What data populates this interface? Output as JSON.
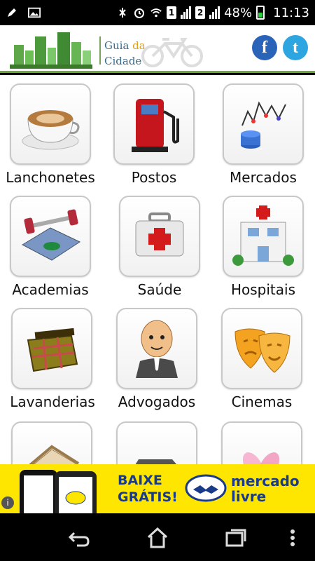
{
  "status_bar": {
    "sim1": "1",
    "sim2": "2",
    "battery": "48%",
    "time": "11:13"
  },
  "header": {
    "logo_text_1a": "Guia",
    "logo_text_1b": "da",
    "logo_text_2": "Cidade",
    "facebook_glyph": "f",
    "twitter_glyph": "t"
  },
  "categories": [
    {
      "label": "Lanchonetes",
      "icon": "coffee-cup-icon"
    },
    {
      "label": "Postos",
      "icon": "gas-pump-icon"
    },
    {
      "label": "Mercados",
      "icon": "market-chart-icon"
    },
    {
      "label": "Academias",
      "icon": "gym-equipment-icon"
    },
    {
      "label": "Saúde",
      "icon": "first-aid-kit-icon"
    },
    {
      "label": "Hospitais",
      "icon": "hospital-icon"
    },
    {
      "label": "Lavanderias",
      "icon": "laundry-basket-icon"
    },
    {
      "label": "Advogados",
      "icon": "lawyer-icon"
    },
    {
      "label": "Cinemas",
      "icon": "theater-masks-icon"
    },
    {
      "label": "",
      "icon": "house-icon"
    },
    {
      "label": "",
      "icon": "car-icon"
    },
    {
      "label": "",
      "icon": "flower-icon"
    }
  ],
  "ad": {
    "line1": "BAIXE",
    "line2": "GRÁTIS!",
    "brand1": "mercado",
    "brand2": "livre",
    "info": "i"
  },
  "colors": {
    "header_accent": "#6aa83a",
    "ad_background": "#ffe600",
    "facebook": "#2a64b8",
    "twitter": "#2ca5e0"
  }
}
